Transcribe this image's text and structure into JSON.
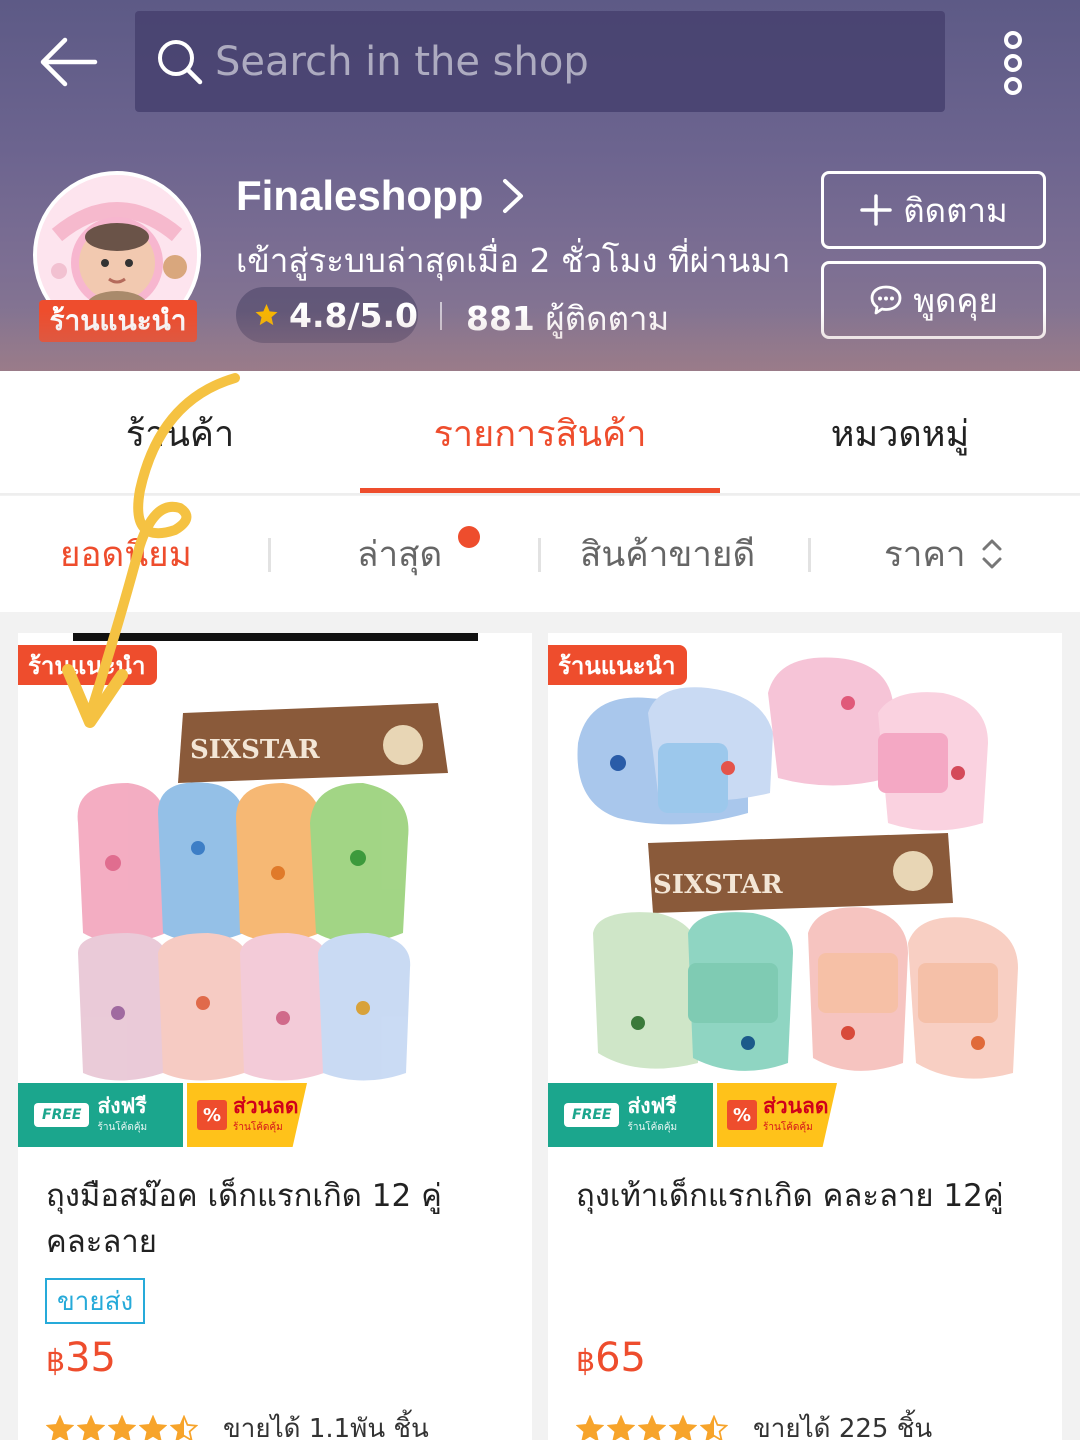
{
  "header": {
    "search_placeholder": "Search in the shop",
    "shop_name": "Finaleshopp",
    "last_login": "เข้าสู่ระบบล่าสุดเมื่อ 2 ชั่วโมง ที่ผ่านมา",
    "rating": "4.8/5.0",
    "followers_count": "881",
    "followers_label": "ผู้ติดตาม",
    "recommended_badge": "ร้านแนะนำ",
    "follow_label": "ติดตาม",
    "chat_label": "พูดคุย"
  },
  "tabs": [
    {
      "label": "ร้านค้า",
      "active": false
    },
    {
      "label": "รายการสินค้า",
      "active": true
    },
    {
      "label": "หมวดหมู่",
      "active": false
    }
  ],
  "sort": [
    {
      "label": "ยอดนิยม",
      "active": true
    },
    {
      "label": "ล่าสุด",
      "active": false
    },
    {
      "label": "สินค้าขายดี",
      "active": false
    },
    {
      "label": "ราคา",
      "active": false
    }
  ],
  "products": [
    {
      "badge": "ร้านแนะนำ",
      "brand": "SIXSTAR",
      "promo_free": "ส่งฟรี",
      "promo_free_sub": "ร้านโค้ดคุ้ม",
      "promo_free_tag": "FREE",
      "promo_disc": "ส่วนลด",
      "promo_disc_sub": "ร้านโค้ดคุ้ม",
      "title": "ถุงมือสม๊อค เด็กแรกเกิด 12 คู่ คละลาย",
      "tag": "ขายส่ง",
      "currency": "฿",
      "price": "35",
      "rating": 4.5,
      "sold": "ขายได้ 1.1พัน ชิ้น"
    },
    {
      "badge": "ร้านแนะนำ",
      "brand": "SIXSTAR",
      "promo_free": "ส่งฟรี",
      "promo_free_sub": "ร้านโค้ดคุ้ม",
      "promo_free_tag": "FREE",
      "promo_disc": "ส่วนลด",
      "promo_disc_sub": "ร้านโค้ดคุ้ม",
      "title": "ถุงเท้าเด็กแรกเกิด คละลาย 12คู่",
      "currency": "฿",
      "price": "65",
      "rating": 4.5,
      "sold": "ขายได้ 225 ชิ้น"
    }
  ],
  "colors": {
    "accent": "#ee4d2d",
    "free_shipping": "#1ba68d",
    "discount": "#ffc21a",
    "wholesale": "#26aad9",
    "star": "#f7a42b",
    "annotation_arrow": "#f5c242"
  },
  "icons": [
    "back-arrow-icon",
    "search-icon",
    "more-vertical-icon",
    "chevron-right-icon",
    "star-icon",
    "plus-icon",
    "chat-bubble-icon",
    "sort-updown-icon"
  ]
}
